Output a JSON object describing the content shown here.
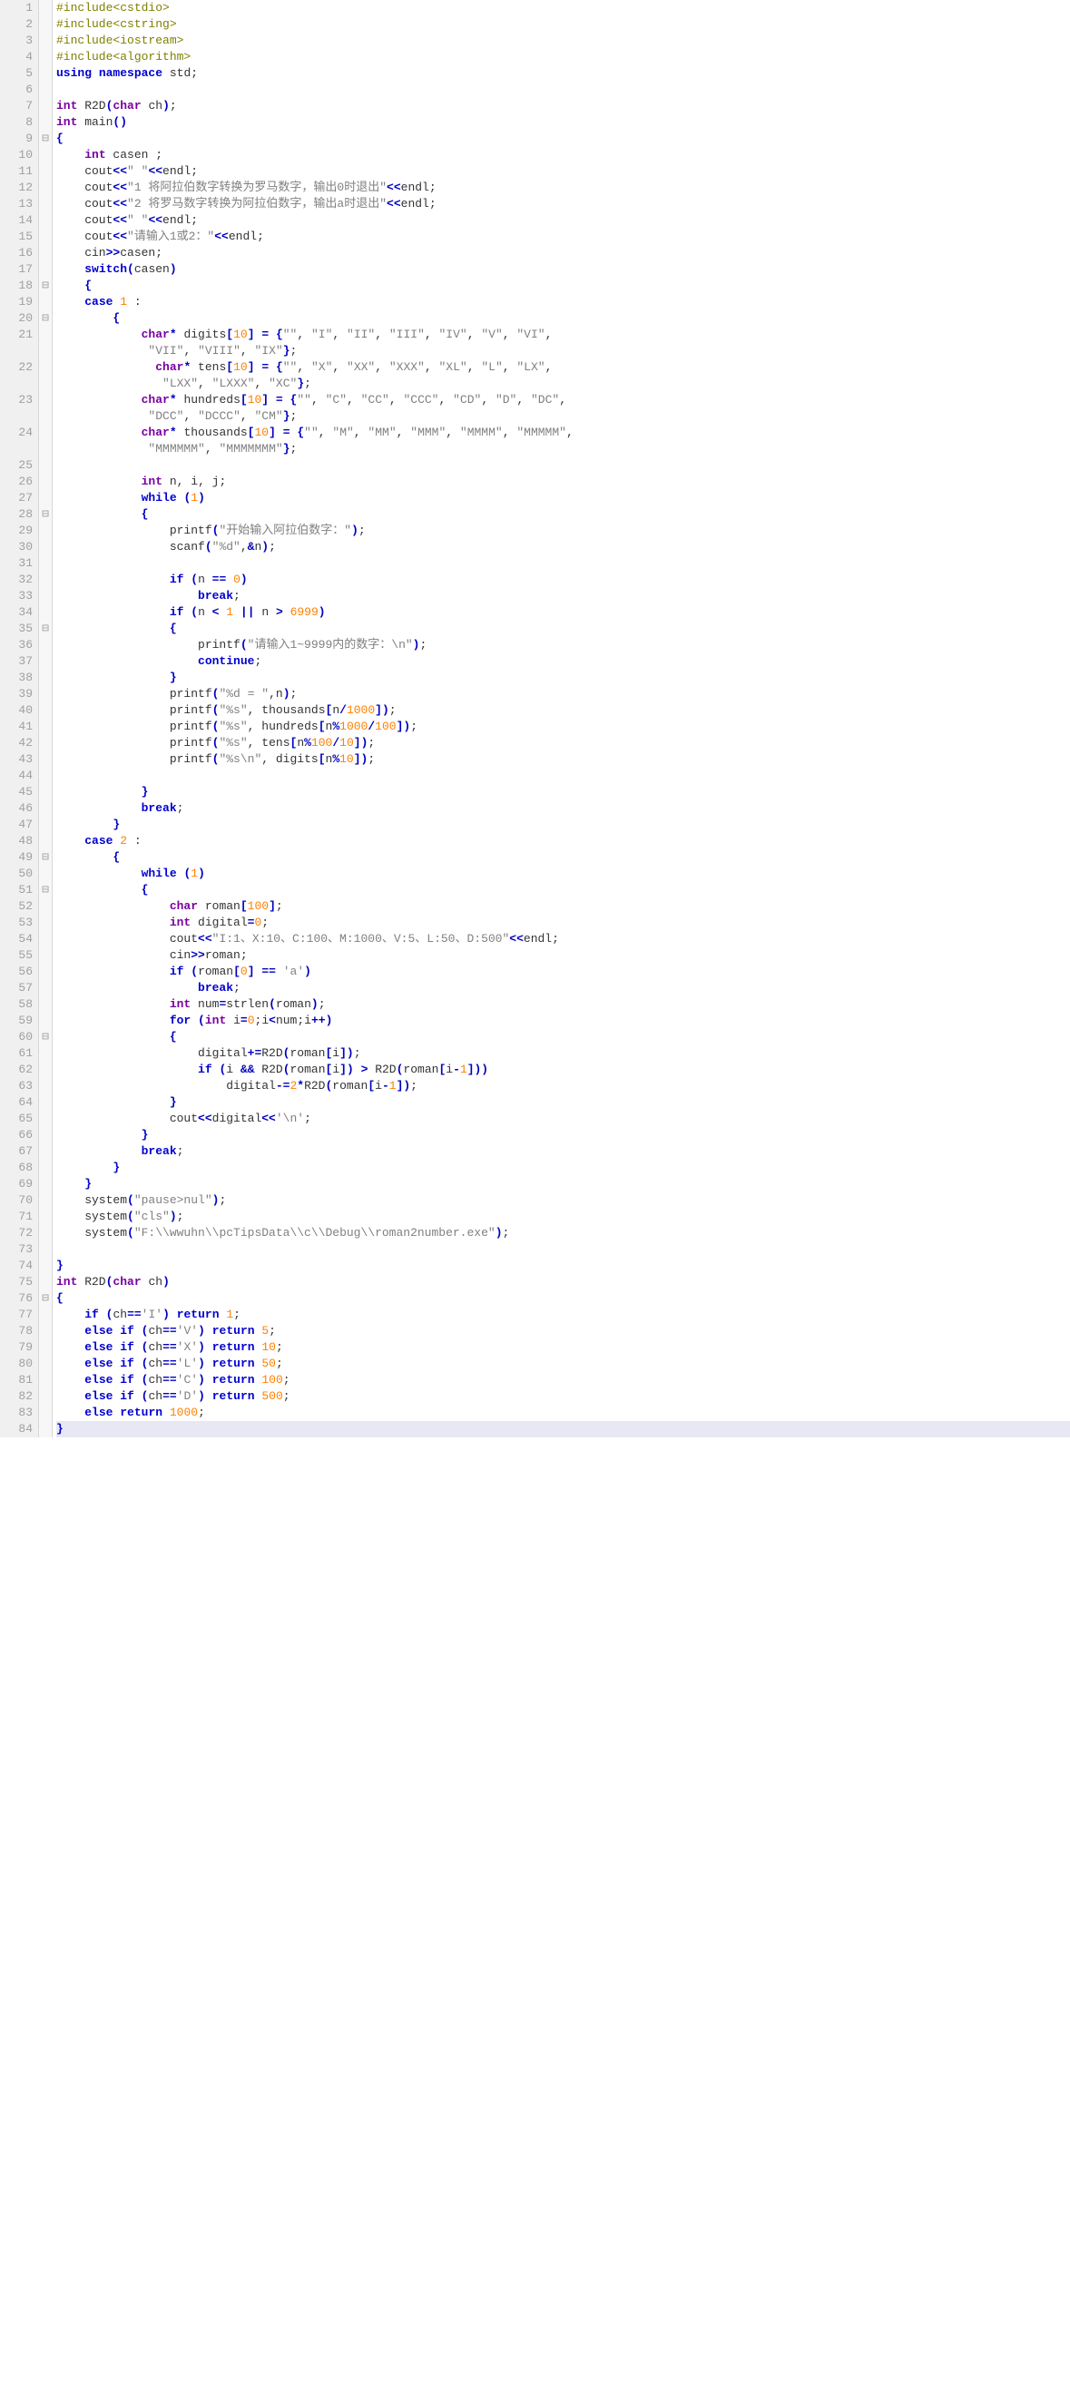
{
  "source": {
    "lines": [
      {
        "ln": 1,
        "fold": "",
        "html": "<span class='pre'>#include&lt;cstdio&gt;</span>"
      },
      {
        "ln": 2,
        "fold": "",
        "html": "<span class='pre'>#include&lt;cstring&gt;</span>"
      },
      {
        "ln": 3,
        "fold": "",
        "html": "<span class='pre'>#include&lt;iostream&gt;</span>"
      },
      {
        "ln": 4,
        "fold": "",
        "html": "<span class='pre'>#include&lt;algorithm&gt;</span>"
      },
      {
        "ln": 5,
        "fold": "",
        "html": "<span class='kw'>using</span> <span class='kw'>namespace</span> std<span class='pun'>;</span>"
      },
      {
        "ln": 6,
        "fold": "",
        "html": ""
      },
      {
        "ln": 7,
        "fold": "",
        "html": "<span class='type'>int</span> R2D<span class='br'>(</span><span class='type'>char</span> ch<span class='br'>)</span><span class='pun'>;</span>"
      },
      {
        "ln": 8,
        "fold": "",
        "html": "<span class='type'>int</span> main<span class='br'>()</span>"
      },
      {
        "ln": 9,
        "fold": "⊟",
        "html": "<span class='br'>{</span>"
      },
      {
        "ln": 10,
        "fold": "",
        "html": "    <span class='type'>int</span> casen <span class='pun'>;</span>"
      },
      {
        "ln": 11,
        "fold": "",
        "html": "    cout<span class='op'>&lt;&lt;</span><span class='str'>\" \"</span><span class='op'>&lt;&lt;</span>endl<span class='pun'>;</span>"
      },
      {
        "ln": 12,
        "fold": "",
        "html": "    cout<span class='op'>&lt;&lt;</span><span class='str'>\"1 将阿拉伯数字转换为罗马数字，输出0时退出\"</span><span class='op'>&lt;&lt;</span>endl<span class='pun'>;</span>"
      },
      {
        "ln": 13,
        "fold": "",
        "html": "    cout<span class='op'>&lt;&lt;</span><span class='str'>\"2 将罗马数字转换为阿拉伯数字，输出a时退出\"</span><span class='op'>&lt;&lt;</span>endl<span class='pun'>;</span>"
      },
      {
        "ln": 14,
        "fold": "",
        "html": "    cout<span class='op'>&lt;&lt;</span><span class='str'>\" \"</span><span class='op'>&lt;&lt;</span>endl<span class='pun'>;</span>"
      },
      {
        "ln": 15,
        "fold": "",
        "html": "    cout<span class='op'>&lt;&lt;</span><span class='str'>\"请输入1或2：\"</span><span class='op'>&lt;&lt;</span>endl<span class='pun'>;</span>"
      },
      {
        "ln": 16,
        "fold": "",
        "html": "    cin<span class='op'>&gt;&gt;</span>casen<span class='pun'>;</span>"
      },
      {
        "ln": 17,
        "fold": "",
        "html": "    <span class='kw'>switch</span><span class='br'>(</span>casen<span class='br'>)</span>"
      },
      {
        "ln": 18,
        "fold": "⊟",
        "html": "    <span class='br'>{</span>"
      },
      {
        "ln": 19,
        "fold": "",
        "html": "    <span class='kw'>case</span> <span class='num'>1</span> <span class='pun'>:</span>"
      },
      {
        "ln": 20,
        "fold": "⊟",
        "html": "        <span class='br'>{</span>"
      },
      {
        "ln": 21,
        "fold": "",
        "html": "            <span class='type'>char</span><span class='op'>*</span> digits<span class='br'>[</span><span class='num'>10</span><span class='br'>]</span> <span class='op'>=</span> <span class='br'>{</span><span class='str'>\"\"</span><span class='pun'>,</span> <span class='str'>\"I\"</span><span class='pun'>,</span> <span class='str'>\"II\"</span><span class='pun'>,</span> <span class='str'>\"III\"</span><span class='pun'>,</span> <span class='str'>\"IV\"</span><span class='pun'>,</span> <span class='str'>\"V\"</span><span class='pun'>,</span> <span class='str'>\"VI\"</span><span class='pun'>,</span>\n             <span class='str'>\"VII\"</span><span class='pun'>,</span> <span class='str'>\"VIII\"</span><span class='pun'>,</span> <span class='str'>\"IX\"</span><span class='br'>}</span><span class='pun'>;</span>"
      },
      {
        "ln": 22,
        "fold": "",
        "html": "              <span class='type'>char</span><span class='op'>*</span> tens<span class='br'>[</span><span class='num'>10</span><span class='br'>]</span> <span class='op'>=</span> <span class='br'>{</span><span class='str'>\"\"</span><span class='pun'>,</span> <span class='str'>\"X\"</span><span class='pun'>,</span> <span class='str'>\"XX\"</span><span class='pun'>,</span> <span class='str'>\"XXX\"</span><span class='pun'>,</span> <span class='str'>\"XL\"</span><span class='pun'>,</span> <span class='str'>\"L\"</span><span class='pun'>,</span> <span class='str'>\"LX\"</span><span class='pun'>,</span>\n               <span class='str'>\"LXX\"</span><span class='pun'>,</span> <span class='str'>\"LXXX\"</span><span class='pun'>,</span> <span class='str'>\"XC\"</span><span class='br'>}</span><span class='pun'>;</span>"
      },
      {
        "ln": 23,
        "fold": "",
        "html": "            <span class='type'>char</span><span class='op'>*</span> hundreds<span class='br'>[</span><span class='num'>10</span><span class='br'>]</span> <span class='op'>=</span> <span class='br'>{</span><span class='str'>\"\"</span><span class='pun'>,</span> <span class='str'>\"C\"</span><span class='pun'>,</span> <span class='str'>\"CC\"</span><span class='pun'>,</span> <span class='str'>\"CCC\"</span><span class='pun'>,</span> <span class='str'>\"CD\"</span><span class='pun'>,</span> <span class='str'>\"D\"</span><span class='pun'>,</span> <span class='str'>\"DC\"</span><span class='pun'>,</span>\n             <span class='str'>\"DCC\"</span><span class='pun'>,</span> <span class='str'>\"DCCC\"</span><span class='pun'>,</span> <span class='str'>\"CM\"</span><span class='br'>}</span><span class='pun'>;</span>"
      },
      {
        "ln": 24,
        "fold": "",
        "html": "            <span class='type'>char</span><span class='op'>*</span> thousands<span class='br'>[</span><span class='num'>10</span><span class='br'>]</span> <span class='op'>=</span> <span class='br'>{</span><span class='str'>\"\"</span><span class='pun'>,</span> <span class='str'>\"M\"</span><span class='pun'>,</span> <span class='str'>\"MM\"</span><span class='pun'>,</span> <span class='str'>\"MMM\"</span><span class='pun'>,</span> <span class='str'>\"MMMM\"</span><span class='pun'>,</span> <span class='str'>\"MMMMM\"</span><span class='pun'>,</span>\n             <span class='str'>\"MMMMMM\"</span><span class='pun'>,</span> <span class='str'>\"MMMMMMM\"</span><span class='br'>}</span><span class='pun'>;</span>"
      },
      {
        "ln": 25,
        "fold": "",
        "html": ""
      },
      {
        "ln": 26,
        "fold": "",
        "html": "            <span class='type'>int</span> n<span class='pun'>,</span> i<span class='pun'>,</span> j<span class='pun'>;</span>"
      },
      {
        "ln": 27,
        "fold": "",
        "html": "            <span class='kw'>while</span> <span class='br'>(</span><span class='num'>1</span><span class='br'>)</span>"
      },
      {
        "ln": 28,
        "fold": "⊟",
        "html": "            <span class='br'>{</span>"
      },
      {
        "ln": 29,
        "fold": "",
        "html": "                printf<span class='br'>(</span><span class='str'>\"开始输入阿拉伯数字：\"</span><span class='br'>)</span><span class='pun'>;</span>"
      },
      {
        "ln": 30,
        "fold": "",
        "html": "                scanf<span class='br'>(</span><span class='str'>\"%d\"</span><span class='pun'>,</span><span class='op'>&amp;</span>n<span class='br'>)</span><span class='pun'>;</span>"
      },
      {
        "ln": 31,
        "fold": "",
        "html": ""
      },
      {
        "ln": 32,
        "fold": "",
        "html": "                <span class='kw'>if</span> <span class='br'>(</span>n <span class='op'>==</span> <span class='num'>0</span><span class='br'>)</span>"
      },
      {
        "ln": 33,
        "fold": "",
        "html": "                    <span class='kw'>break</span><span class='pun'>;</span>"
      },
      {
        "ln": 34,
        "fold": "",
        "html": "                <span class='kw'>if</span> <span class='br'>(</span>n <span class='op'>&lt;</span> <span class='num'>1</span> <span class='op'>||</span> n <span class='op'>&gt;</span> <span class='num'>6999</span><span class='br'>)</span>"
      },
      {
        "ln": 35,
        "fold": "⊟",
        "html": "                <span class='br'>{</span>"
      },
      {
        "ln": 36,
        "fold": "",
        "html": "                    printf<span class='br'>(</span><span class='str'>\"请输入1~9999内的数字：\\n\"</span><span class='br'>)</span><span class='pun'>;</span>"
      },
      {
        "ln": 37,
        "fold": "",
        "html": "                    <span class='kw'>continue</span><span class='pun'>;</span>"
      },
      {
        "ln": 38,
        "fold": "",
        "html": "                <span class='br'>}</span>"
      },
      {
        "ln": 39,
        "fold": "",
        "html": "                printf<span class='br'>(</span><span class='str'>\"%d = \"</span><span class='pun'>,</span>n<span class='br'>)</span><span class='pun'>;</span>"
      },
      {
        "ln": 40,
        "fold": "",
        "html": "                printf<span class='br'>(</span><span class='str'>\"%s\"</span><span class='pun'>,</span> thousands<span class='br'>[</span>n<span class='op'>/</span><span class='num'>1000</span><span class='br'>])</span><span class='pun'>;</span>"
      },
      {
        "ln": 41,
        "fold": "",
        "html": "                printf<span class='br'>(</span><span class='str'>\"%s\"</span><span class='pun'>,</span> hundreds<span class='br'>[</span>n<span class='op'>%</span><span class='num'>1000</span><span class='op'>/</span><span class='num'>100</span><span class='br'>])</span><span class='pun'>;</span>"
      },
      {
        "ln": 42,
        "fold": "",
        "html": "                printf<span class='br'>(</span><span class='str'>\"%s\"</span><span class='pun'>,</span> tens<span class='br'>[</span>n<span class='op'>%</span><span class='num'>100</span><span class='op'>/</span><span class='num'>10</span><span class='br'>])</span><span class='pun'>;</span>"
      },
      {
        "ln": 43,
        "fold": "",
        "html": "                printf<span class='br'>(</span><span class='str'>\"%s\\n\"</span><span class='pun'>,</span> digits<span class='br'>[</span>n<span class='op'>%</span><span class='num'>10</span><span class='br'>])</span><span class='pun'>;</span>"
      },
      {
        "ln": 44,
        "fold": "",
        "html": ""
      },
      {
        "ln": 45,
        "fold": "",
        "html": "            <span class='br'>}</span>"
      },
      {
        "ln": 46,
        "fold": "",
        "html": "            <span class='kw'>break</span><span class='pun'>;</span>"
      },
      {
        "ln": 47,
        "fold": "",
        "html": "        <span class='br'>}</span>"
      },
      {
        "ln": 48,
        "fold": "",
        "html": "    <span class='kw'>case</span> <span class='num'>2</span> <span class='pun'>:</span>"
      },
      {
        "ln": 49,
        "fold": "⊟",
        "html": "        <span class='br'>{</span>"
      },
      {
        "ln": 50,
        "fold": "",
        "html": "            <span class='kw'>while</span> <span class='br'>(</span><span class='num'>1</span><span class='br'>)</span>"
      },
      {
        "ln": 51,
        "fold": "⊟",
        "html": "            <span class='br'>{</span>"
      },
      {
        "ln": 52,
        "fold": "",
        "html": "                <span class='type'>char</span> roman<span class='br'>[</span><span class='num'>100</span><span class='br'>]</span><span class='pun'>;</span>"
      },
      {
        "ln": 53,
        "fold": "",
        "html": "                <span class='type'>int</span> digital<span class='op'>=</span><span class='num'>0</span><span class='pun'>;</span>"
      },
      {
        "ln": 54,
        "fold": "",
        "html": "                cout<span class='op'>&lt;&lt;</span><span class='str'>\"I:1、X:10、C:100、M:1000、V:5、L:50、D:500\"</span><span class='op'>&lt;&lt;</span>endl<span class='pun'>;</span>"
      },
      {
        "ln": 55,
        "fold": "",
        "html": "                cin<span class='op'>&gt;&gt;</span>roman<span class='pun'>;</span>"
      },
      {
        "ln": 56,
        "fold": "",
        "html": "                <span class='kw'>if</span> <span class='br'>(</span>roman<span class='br'>[</span><span class='num'>0</span><span class='br'>]</span> <span class='op'>==</span> <span class='str'>'a'</span><span class='br'>)</span>"
      },
      {
        "ln": 57,
        "fold": "",
        "html": "                    <span class='kw'>break</span><span class='pun'>;</span>"
      },
      {
        "ln": 58,
        "fold": "",
        "html": "                <span class='type'>int</span> num<span class='op'>=</span>strlen<span class='br'>(</span>roman<span class='br'>)</span><span class='pun'>;</span>"
      },
      {
        "ln": 59,
        "fold": "",
        "html": "                <span class='kw'>for</span> <span class='br'>(</span><span class='type'>int</span> i<span class='op'>=</span><span class='num'>0</span><span class='pun'>;</span>i<span class='op'>&lt;</span>num<span class='pun'>;</span>i<span class='op'>++</span><span class='br'>)</span>"
      },
      {
        "ln": 60,
        "fold": "⊟",
        "html": "                <span class='br'>{</span>"
      },
      {
        "ln": 61,
        "fold": "",
        "html": "                    digital<span class='op'>+=</span>R2D<span class='br'>(</span>roman<span class='br'>[</span>i<span class='br'>])</span><span class='pun'>;</span>"
      },
      {
        "ln": 62,
        "fold": "",
        "html": "                    <span class='kw'>if</span> <span class='br'>(</span>i <span class='op'>&amp;&amp;</span> R2D<span class='br'>(</span>roman<span class='br'>[</span>i<span class='br'>])</span> <span class='op'>&gt;</span> R2D<span class='br'>(</span>roman<span class='br'>[</span>i<span class='op'>-</span><span class='num'>1</span><span class='br'>]))</span>"
      },
      {
        "ln": 63,
        "fold": "",
        "html": "                        digital<span class='op'>-=</span><span class='num'>2</span><span class='op'>*</span>R2D<span class='br'>(</span>roman<span class='br'>[</span>i<span class='op'>-</span><span class='num'>1</span><span class='br'>])</span><span class='pun'>;</span>"
      },
      {
        "ln": 64,
        "fold": "",
        "html": "                <span class='br'>}</span>"
      },
      {
        "ln": 65,
        "fold": "",
        "html": "                cout<span class='op'>&lt;&lt;</span>digital<span class='op'>&lt;&lt;</span><span class='str'>'\\n'</span><span class='pun'>;</span>"
      },
      {
        "ln": 66,
        "fold": "",
        "html": "            <span class='br'>}</span>"
      },
      {
        "ln": 67,
        "fold": "",
        "html": "            <span class='kw'>break</span><span class='pun'>;</span>"
      },
      {
        "ln": 68,
        "fold": "",
        "html": "        <span class='br'>}</span>"
      },
      {
        "ln": 69,
        "fold": "",
        "html": "    <span class='br'>}</span>"
      },
      {
        "ln": 70,
        "fold": "",
        "html": "    system<span class='br'>(</span><span class='str'>\"pause&gt;nul\"</span><span class='br'>)</span><span class='pun'>;</span>"
      },
      {
        "ln": 71,
        "fold": "",
        "html": "    system<span class='br'>(</span><span class='str'>\"cls\"</span><span class='br'>)</span><span class='pun'>;</span>"
      },
      {
        "ln": 72,
        "fold": "",
        "html": "    system<span class='br'>(</span><span class='str'>\"F:\\\\wwuhn\\\\pcTipsData\\\\c\\\\Debug\\\\roman2number.exe\"</span><span class='br'>)</span><span class='pun'>;</span>"
      },
      {
        "ln": 73,
        "fold": "",
        "html": ""
      },
      {
        "ln": 74,
        "fold": "",
        "html": "<span class='br'>}</span>"
      },
      {
        "ln": 75,
        "fold": "",
        "html": "<span class='type'>int</span> R2D<span class='br'>(</span><span class='type'>char</span> ch<span class='br'>)</span>"
      },
      {
        "ln": 76,
        "fold": "⊟",
        "html": "<span class='red'><span class='br'>{</span></span>"
      },
      {
        "ln": 77,
        "fold": "",
        "html": "    <span class='kw'>if</span> <span class='br'>(</span>ch<span class='op'>==</span><span class='str'>'I'</span><span class='br'>)</span> <span class='kw'>return</span> <span class='num'>1</span><span class='pun'>;</span>"
      },
      {
        "ln": 78,
        "fold": "",
        "html": "    <span class='kw'>else</span> <span class='kw'>if</span> <span class='br'>(</span>ch<span class='op'>==</span><span class='str'>'V'</span><span class='br'>)</span> <span class='kw'>return</span> <span class='num'>5</span><span class='pun'>;</span>"
      },
      {
        "ln": 79,
        "fold": "",
        "html": "    <span class='kw'>else</span> <span class='kw'>if</span> <span class='br'>(</span>ch<span class='op'>==</span><span class='str'>'X'</span><span class='br'>)</span> <span class='kw'>return</span> <span class='num'>10</span><span class='pun'>;</span>"
      },
      {
        "ln": 80,
        "fold": "",
        "html": "    <span class='kw'>else</span> <span class='kw'>if</span> <span class='br'>(</span>ch<span class='op'>==</span><span class='str'>'L'</span><span class='br'>)</span> <span class='kw'>return</span> <span class='num'>50</span><span class='pun'>;</span>"
      },
      {
        "ln": 81,
        "fold": "",
        "html": "    <span class='kw'>else</span> <span class='kw'>if</span> <span class='br'>(</span>ch<span class='op'>==</span><span class='str'>'C'</span><span class='br'>)</span> <span class='kw'>return</span> <span class='num'>100</span><span class='pun'>;</span>"
      },
      {
        "ln": 82,
        "fold": "",
        "html": "    <span class='kw'>else</span> <span class='kw'>if</span> <span class='br'>(</span>ch<span class='op'>==</span><span class='str'>'D'</span><span class='br'>)</span> <span class='kw'>return</span> <span class='num'>500</span><span class='pun'>;</span>"
      },
      {
        "ln": 83,
        "fold": "",
        "html": "    <span class='kw'>else</span> <span class='kw'>return</span> <span class='num'>1000</span><span class='pun'>;</span>"
      },
      {
        "ln": 84,
        "fold": "",
        "html": "<span class='red'><span class='br'>}</span></span>",
        "last": true
      }
    ]
  }
}
